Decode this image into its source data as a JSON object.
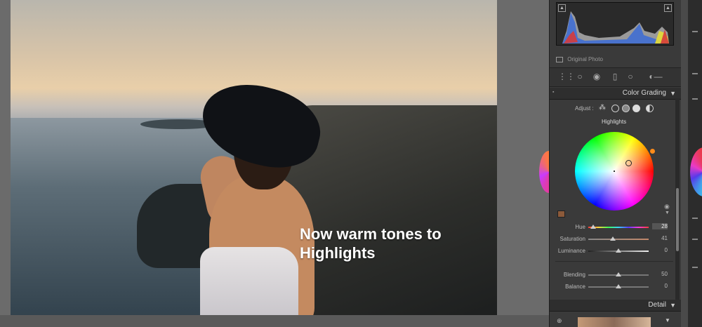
{
  "caption": {
    "line1": "Now warm tones to",
    "line2": "Highlights"
  },
  "histogram": {
    "original_photo_label": "Original Photo"
  },
  "color_grading": {
    "title": "Color Grading",
    "adjust_label": "Adjust :",
    "selected_mode": "Highlights",
    "wheel_label": "Highlights",
    "swatch_color": "#8c5a3a",
    "sliders": [
      {
        "label": "Hue",
        "value": "28",
        "fraction": 0.08,
        "gradient": "linear-gradient(90deg,#ff3b3b,#ffd43b,#3bff57,#3bd1ff,#5b3bff,#ff3bd8,#ff3b3b)"
      },
      {
        "label": "Saturation",
        "value": "41",
        "fraction": 0.41,
        "gradient": "linear-gradient(90deg,#888,#c2886a)"
      },
      {
        "label": "Luminance",
        "value": "0",
        "fraction": 0.5,
        "gradient": "linear-gradient(90deg,#222,#eee)"
      }
    ],
    "blending": {
      "label": "Blending",
      "value": "50",
      "fraction": 0.5
    },
    "balance": {
      "label": "Balance",
      "value": "0",
      "fraction": 0.5
    }
  },
  "detail": {
    "title": "Detail"
  }
}
